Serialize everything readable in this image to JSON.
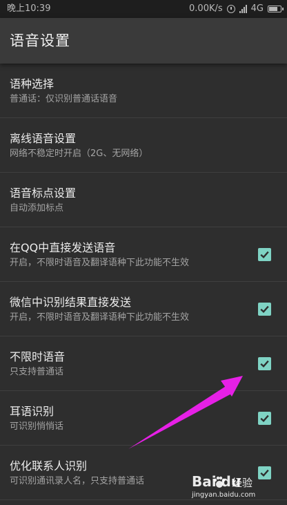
{
  "status_bar": {
    "time": "晚上10:39",
    "speed": "0.00K/s",
    "network": "4G"
  },
  "app_bar": {
    "title": "语音设置"
  },
  "settings": [
    {
      "title": "语种选择",
      "subtitle": "普通话：仅识别普通话语音",
      "checkbox": false
    },
    {
      "title": "离线语音设置",
      "subtitle": "网络不稳定时开启（2G、无网络）",
      "checkbox": false
    },
    {
      "title": "语音标点设置",
      "subtitle": "自动添加标点",
      "checkbox": false
    },
    {
      "title": "在QQ中直接发送语音",
      "subtitle": "开启，不限时语音及翻译语种下此功能不生效",
      "checkbox": true,
      "checked": true
    },
    {
      "title": "微信中识别结果直接发送",
      "subtitle": "开启，不限时语音及翻译语种下此功能不生效",
      "checkbox": true,
      "checked": true
    },
    {
      "title": "不限时语音",
      "subtitle": "只支持普通话",
      "checkbox": true,
      "checked": true
    },
    {
      "title": "耳语识别",
      "subtitle": "可识别悄悄话",
      "checkbox": true,
      "checked": true
    },
    {
      "title": "优化联系人识别",
      "subtitle": "可识别通讯录人名，只支持普通话",
      "checkbox": true,
      "checked": true
    }
  ],
  "watermark": {
    "logo": "Bai du",
    "jingyan": "经验",
    "url": "jingyan.baidu.com"
  },
  "colors": {
    "checkbox_fill": "#7fd3c4",
    "arrow": "#e620e6",
    "background": "#2e2e2e",
    "app_bar": "#3a3a3a"
  }
}
